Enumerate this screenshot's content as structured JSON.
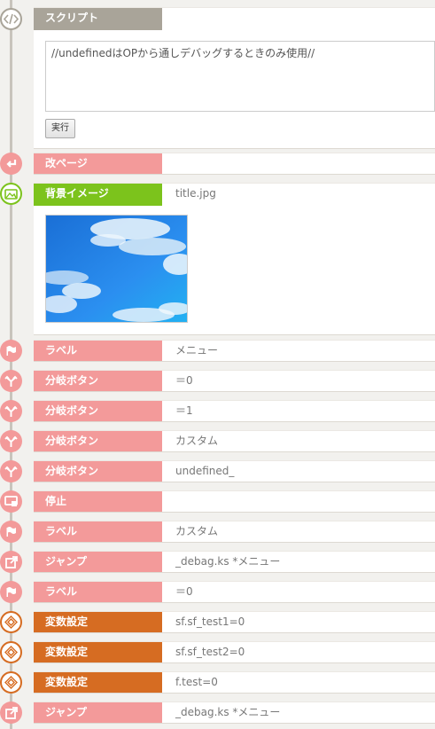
{
  "script": {
    "label": "スクリプト",
    "code": "//undefinedはOPから通しデバッグするときのみ使用//",
    "run_button": "実行"
  },
  "rows": [
    {
      "label": "改ページ",
      "value": ""
    },
    {
      "label": "背景イメージ",
      "value": "title.jpg"
    },
    {
      "label": "ラベル",
      "value": "メニュー"
    },
    {
      "label": "分岐ボタン",
      "value": "＝0"
    },
    {
      "label": "分岐ボタン",
      "value": "＝1"
    },
    {
      "label": "分岐ボタン",
      "value": "カスタム"
    },
    {
      "label": "分岐ボタン",
      "value": "undefined_"
    },
    {
      "label": "停止",
      "value": ""
    },
    {
      "label": "ラベル",
      "value": "カスタム"
    },
    {
      "label": "ジャンプ",
      "value": "_debag.ks *メニュー"
    },
    {
      "label": "ラベル",
      "value": "＝0"
    },
    {
      "label": "変数設定",
      "value": "sf.sf_test1=0"
    },
    {
      "label": "変数設定",
      "value": "sf.sf_test2=0"
    },
    {
      "label": "変数設定",
      "value": "f.test=0"
    },
    {
      "label": "ジャンプ",
      "value": "_debag.ks *メニュー"
    }
  ],
  "colors": {
    "pink": "#f39a9a",
    "green": "#7cc31c",
    "orange": "#d66c22",
    "gray": "#a9a499"
  },
  "icons": [
    "code-icon",
    "page-break-icon",
    "image-icon",
    "flag-icon",
    "branch-icon",
    "branch-icon",
    "branch-icon",
    "branch-icon",
    "stop-icon",
    "flag-icon",
    "jump-icon",
    "flag-icon",
    "variable-icon",
    "variable-icon",
    "variable-icon",
    "jump-icon"
  ]
}
